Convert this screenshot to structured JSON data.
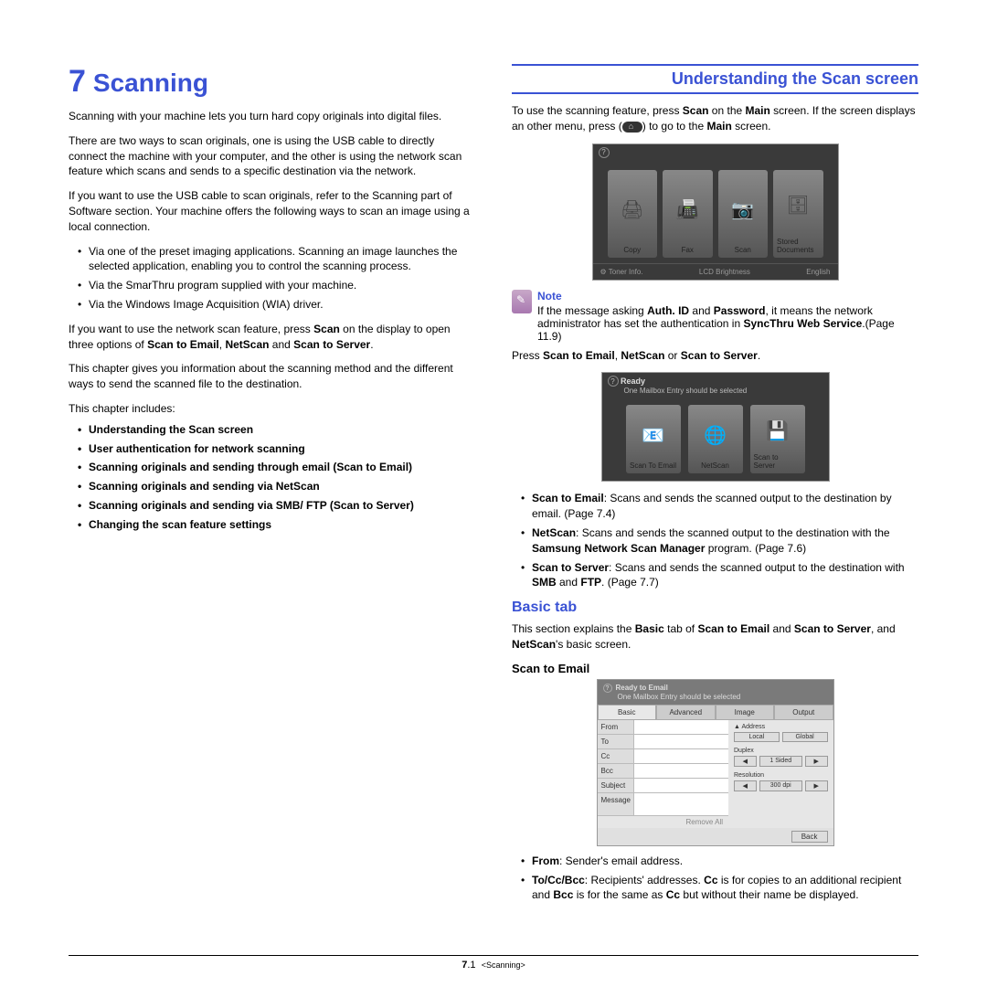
{
  "chapter": {
    "num": "7",
    "title": "Scanning"
  },
  "left": {
    "p1": "Scanning with your machine lets you turn hard copy originals into digital files.",
    "p2": "There are two ways to scan originals, one is using the USB cable to directly connect the machine with your computer, and the other is using the network scan feature which scans and sends to a specific destination via the network.",
    "p3": "If you want to use the USB cable to scan originals, refer to the Scanning part of Software section. Your machine offers the following ways to scan an image using a local connection.",
    "bul": [
      "Via one of the preset imaging applications. Scanning an image launches the selected application, enabling you to control the scanning process.",
      "Via the SmarThru program supplied with your machine.",
      "Via the Windows Image Acquisition (WIA) driver."
    ],
    "p4a": "If you want to use the network scan feature, press ",
    "p4b": " on the display to open three options of ",
    "p4c": " and ",
    "p4d": ".",
    "p4_scan": "Scan",
    "p4_s2e": "Scan to Email",
    "p4_ns": "NetScan",
    "p4_s2s": "Scan to Server",
    "p5": "This chapter gives you information about the scanning method and the different ways to send the scanned file to the destination.",
    "p6": "This chapter includes:",
    "toc": [
      "Understanding the Scan screen",
      "User authentication for network scanning",
      "Scanning originals and sending through email (Scan to Email)",
      "Scanning originals and sending via NetScan",
      "Scanning originals and sending via SMB/ FTP (Scan to Server)",
      "Changing the scan feature settings"
    ]
  },
  "right": {
    "head": "Understanding the Scan screen",
    "p1a": "To use the scanning feature, press ",
    "p1b": " on the ",
    "p1c": " screen. If the screen displays an other menu, press (",
    "p1d": ") to go to the ",
    "p1e": " screen.",
    "scan": "Scan",
    "main": "Main",
    "tiles_main": [
      "Copy",
      "Fax",
      "Scan",
      "Stored Documents"
    ],
    "bot_main": [
      "⚙ Toner Info.",
      "LCD Brightness",
      "English"
    ],
    "note_label": "Note",
    "note_a": "If the message asking ",
    "note_b": " and ",
    "note_c": ", it means the network administrator has set the authentication in ",
    "note_d": ".(Page 11.9)",
    "auth": "Auth. ID",
    "pwd": "Password",
    "sync": "SyncThru Web Service",
    "p2a": "Press ",
    "p2b": ", ",
    "p2c": " or ",
    "p2d": ".",
    "s2e": "Scan to Email",
    "ns": "NetScan",
    "s2s": "Scan to Server",
    "scan_hdr": "Ready",
    "scan_msg": "One Mailbox Entry should be selected",
    "tiles_scan": [
      "Scan To Email",
      "NetScan",
      "Scan to Server"
    ],
    "defs": [
      {
        "t": "Scan to Email",
        "d": ": Scans and sends the scanned output to the destination by email. (Page 7.4)"
      },
      {
        "t": "NetScan",
        "d_a": ": Scans and sends the scanned output to the destination with the ",
        "d_b": "Samsung Network Scan Manager",
        "d_c": " program. (Page 7.6)"
      },
      {
        "t": "Scan to Server",
        "d_a": ": Scans and sends the scanned output to the destination with ",
        "d_b": "SMB",
        "d_c": " and ",
        "d_d": "FTP",
        "d_e": ". (Page 7.7)"
      }
    ],
    "basic_head": "Basic tab",
    "basic_p_a": "This section explains the ",
    "basic_p_b": " tab of ",
    "basic_p_c": " and ",
    "basic_p_d": ", and ",
    "basic_p_e": "'s basic screen.",
    "basic": "Basic",
    "s2e2": "Scan to Email",
    "s2s2": "Scan to Server",
    "ns2": "NetScan",
    "sub2": "Scan to Email",
    "email": {
      "hdr": "Ready to Email",
      "msg": "One Mailbox Entry should be selected",
      "tabs": [
        "Basic",
        "Advanced",
        "Image",
        "Output"
      ],
      "fields": [
        "From",
        "To",
        "Cc",
        "Bcc",
        "Subject",
        "Message"
      ],
      "side": {
        "addr": "Address",
        "btns": [
          "Local",
          "Global"
        ],
        "dup": "Duplex",
        "res": "Resolution",
        "resval": "300 dpi"
      },
      "remove": "Remove All",
      "back": "Back"
    },
    "from_a": "From",
    "from_b": ": Sender's email address.",
    "tcb_a": "To/Cc/Bcc",
    "tcb_b": ": Recipients' addresses. ",
    "tcb_c": "Cc",
    "tcb_d": " is for copies to an additional recipient and ",
    "tcb_e": "Bcc",
    "tcb_f": " is for the same as ",
    "tcb_g": "Cc",
    "tcb_h": " but without their name be displayed."
  },
  "footer": {
    "num": "7",
    "sub": ".1",
    "tag": "<Scanning>"
  }
}
